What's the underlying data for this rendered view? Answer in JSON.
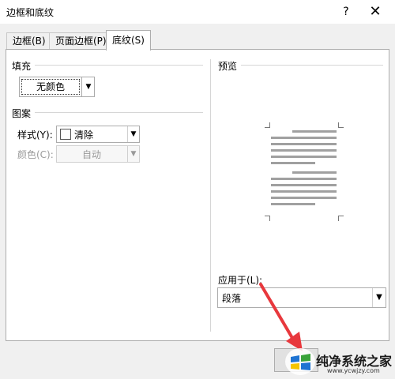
{
  "window": {
    "title": "边框和底纹",
    "help_label": "?",
    "close_label": "✕"
  },
  "tabs": [
    {
      "label": "边框(B)",
      "active": false
    },
    {
      "label": "页面边框(P)",
      "active": false
    },
    {
      "label": "底纹(S)",
      "active": true
    }
  ],
  "fill": {
    "section_label": "填充",
    "color_value": "无颜色"
  },
  "pattern": {
    "section_label": "图案",
    "style_label": "样式(Y):",
    "style_value": "清除",
    "color_label": "颜色(C):",
    "color_value": "自动"
  },
  "preview": {
    "section_label": "预览"
  },
  "apply_to": {
    "label": "应用于(L):",
    "value": "段落"
  },
  "watermark": {
    "text": "纯净系统之家",
    "url": "www.ycwjzy.com"
  },
  "colors": {
    "arrow": "#e8383d",
    "logo_blue": "#1e73d2",
    "logo_green": "#3aa33a",
    "logo_yellow": "#f5c400"
  }
}
